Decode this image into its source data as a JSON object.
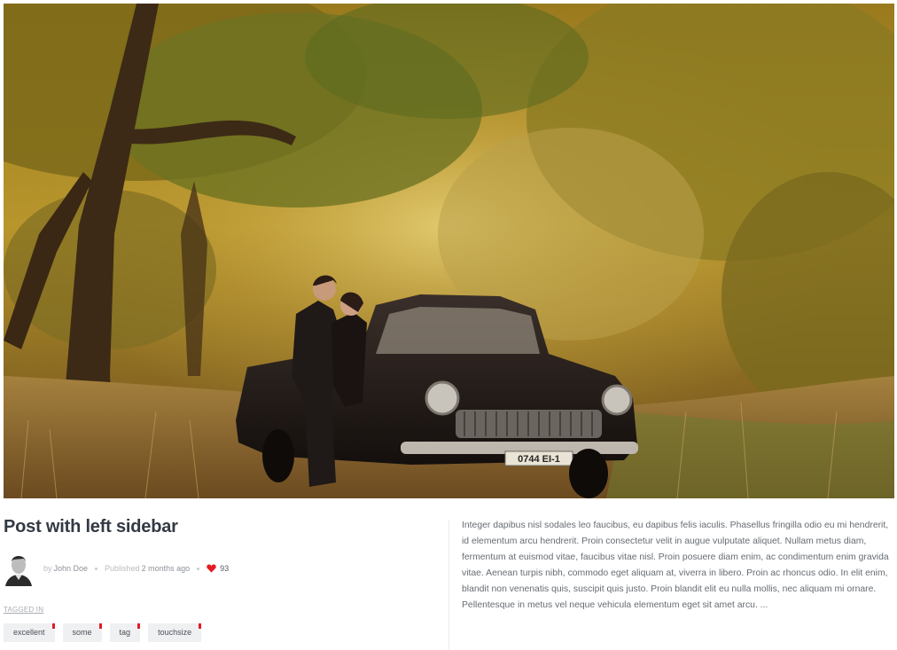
{
  "post": {
    "title": "Post with left sidebar",
    "author_prefix": "by",
    "author": "John Doe",
    "published_prefix": "Published",
    "published": "2 months ago",
    "likes": "93",
    "tagged_label": "TAGGED IN",
    "tags": [
      "excellent",
      "some",
      "tag",
      "touchsize"
    ],
    "excerpt": "Integer dapibus nisl sodales leo faucibus, eu dapibus felis iaculis. Phasellus fringilla odio eu mi hendrerit, id elementum arcu hendrerit. Proin consectetur velit in augue vulputate aliquet. Nullam metus diam, fermentum at euismod vitae, faucibus vitae nisl. Proin posuere diam enim, ac condimentum enim gravida vitae. Aenean turpis nibh, commodo eget aliquam at, viverra in libero. Proin ac rhoncus odio. In elit enim, blandit non venenatis quis, suscipit quis justo. Proin blandit elit eu nulla mollis, nec aliquam mi ornare. Pellentesque in metus vel neque vehicula elementum eget sit amet arcu. ...",
    "license_plate": "0744 EI-1"
  },
  "colors": {
    "accent": "#e31b23",
    "title": "#333a44",
    "tag_bg": "#eef0f2"
  },
  "icons": {
    "likes": "heart-icon"
  }
}
